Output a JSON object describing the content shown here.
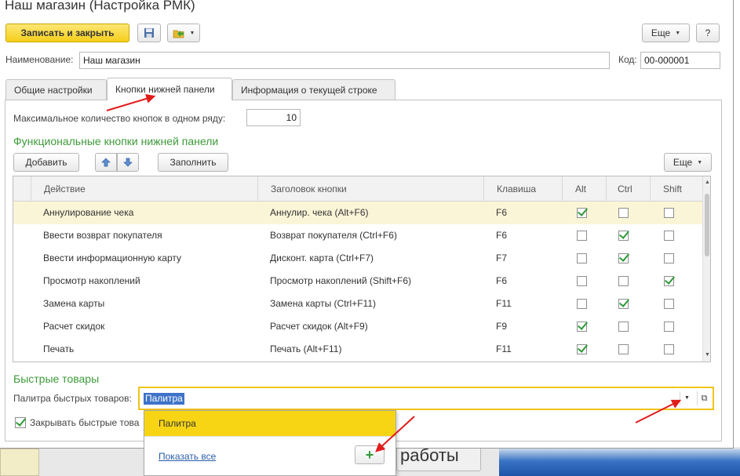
{
  "window": {
    "title": "Наш магазин (Настройка РМК)"
  },
  "toolbar": {
    "save_close_label": "Записать и закрыть",
    "more_label": "Еще",
    "help_label": "?"
  },
  "form": {
    "name_label": "Наименование:",
    "name_value": "Наш магазин",
    "code_label": "Код:",
    "code_value": "00-000001"
  },
  "tabs": [
    {
      "label": "Общие настройки",
      "active": false
    },
    {
      "label": "Кнопки нижней панели",
      "active": true
    },
    {
      "label": "Информация о текущей строке",
      "active": false
    }
  ],
  "panel": {
    "max_buttons_label": "Максимальное количество кнопок в одном ряду:",
    "max_buttons_value": "10",
    "functional_title": "Функциональные кнопки нижней панели",
    "add_label": "Добавить",
    "fill_label": "Заполнить",
    "more_label": "Еще"
  },
  "table": {
    "columns": {
      "action": "Действие",
      "caption": "Заголовок кнопки",
      "key": "Клавиша",
      "alt": "Alt",
      "ctrl": "Ctrl",
      "shift": "Shift"
    },
    "rows": [
      {
        "action": "Аннулирование чека",
        "caption": "Аннулир. чека (Alt+F6)",
        "key": "F6",
        "alt": true,
        "ctrl": false,
        "shift": false
      },
      {
        "action": "Ввести возврат покупателя",
        "caption": "Возврат покупателя (Ctrl+F6)",
        "key": "F6",
        "alt": false,
        "ctrl": true,
        "shift": false
      },
      {
        "action": "Ввести информационную карту",
        "caption": "Дисконт. карта (Ctrl+F7)",
        "key": "F7",
        "alt": false,
        "ctrl": true,
        "shift": false
      },
      {
        "action": "Просмотр накоплений",
        "caption": "Просмотр накоплений (Shift+F6)",
        "key": "F6",
        "alt": false,
        "ctrl": false,
        "shift": true
      },
      {
        "action": "Замена карты",
        "caption": "Замена карты (Ctrl+F11)",
        "key": "F11",
        "alt": false,
        "ctrl": true,
        "shift": false
      },
      {
        "action": "Расчет скидок",
        "caption": "Расчет скидок (Alt+F9)",
        "key": "F9",
        "alt": true,
        "ctrl": false,
        "shift": false
      },
      {
        "action": "Печать",
        "caption": "Печать (Alt+F11)",
        "key": "F11",
        "alt": true,
        "ctrl": false,
        "shift": false
      }
    ]
  },
  "quick": {
    "title": "Быстрые товары",
    "palette_label": "Палитра быстрых товаров:",
    "palette_value": "Палитра",
    "close_label": "Закрывать быстрые това"
  },
  "dropdown": {
    "option": "Палитра",
    "show_all": "Показать все"
  },
  "background": {
    "button_text": "работы"
  },
  "colors": {
    "accent_yellow": "#f5cf1b",
    "section_green": "#3d9a3a",
    "annotation_red": "#e21b1b",
    "selection_blue": "#3d73c9"
  }
}
